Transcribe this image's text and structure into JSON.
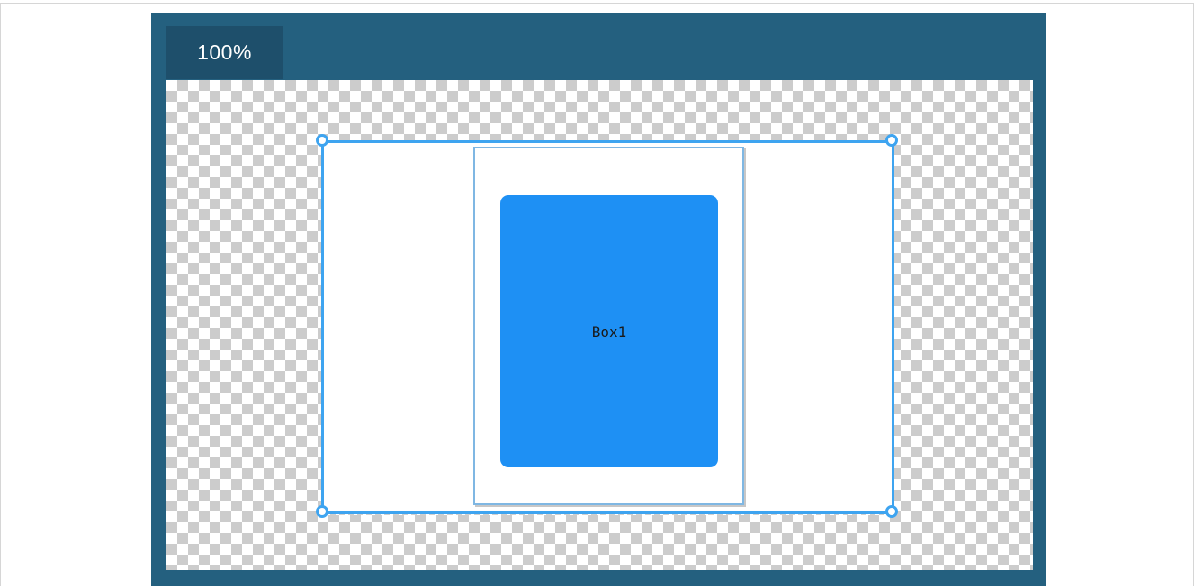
{
  "editor": {
    "zoom_label": "100%"
  },
  "canvas": {
    "elements": [
      {
        "label": "Box1"
      }
    ]
  },
  "colors": {
    "frame": "#24607f",
    "zoom_badge": "#1e4f6b",
    "selection": "#3ea4f0",
    "box_fill": "#1e90f4",
    "container_border": "#7fb7e3"
  }
}
